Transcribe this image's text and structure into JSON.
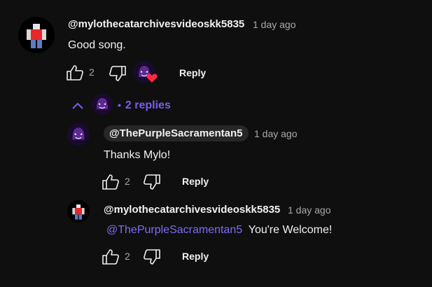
{
  "comment": {
    "author": "@mylothecatarchivesvideoskk5835",
    "time": "1 day ago",
    "text": "Good song.",
    "likes": "2",
    "reply_label": "Reply"
  },
  "replies_toggle": {
    "dot": "•",
    "label": "2 replies"
  },
  "reply1": {
    "author": "@ThePurpleSacramentan5",
    "time": "1 day ago",
    "text": "Thanks Mylo!",
    "likes": "2",
    "reply_label": "Reply"
  },
  "reply2": {
    "author": "@mylothecatarchivesvideoskk5835",
    "time": "1 day ago",
    "mention": "@ThePurpleSacramentan5",
    "text": "You're Welcome!",
    "likes": "2",
    "reply_label": "Reply"
  },
  "colors": {
    "background": "#0f0f0f",
    "link": "#7c5cf0",
    "heart": "#ff2a3c"
  }
}
